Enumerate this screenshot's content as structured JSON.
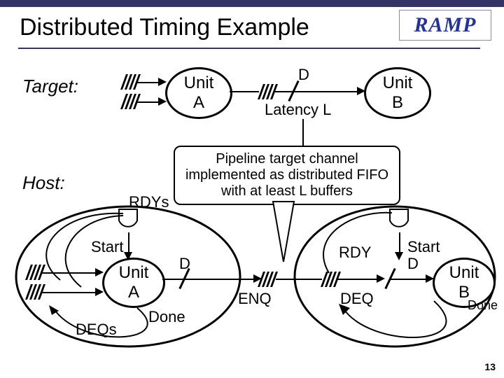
{
  "slide": {
    "title": "Distributed Timing Example",
    "page_number": "13"
  },
  "logo": {
    "text": "RAMP"
  },
  "sections": {
    "target": "Target:",
    "host": "Host:"
  },
  "units": {
    "a": "Unit\nA",
    "b": "Unit\nB"
  },
  "signals": {
    "d": "D",
    "latency": "Latency L",
    "rdys": "RDYs",
    "rdy": "RDY",
    "start": "Start",
    "enq": "ENQ",
    "deq": "DEQ",
    "deqs": "DEQs",
    "done": "Done"
  },
  "callout": {
    "text": "Pipeline target channel implemented as distributed FIFO with at least L buffers"
  },
  "chart_data": {
    "type": "table",
    "description": "Block diagram: two abstraction levels (Target, Host) mapping Unit A → channel of latency L → Unit B; host side shows distributed FIFO with ENQ/DEQ, RDY/Start/Done control and AND gates.",
    "target_level": {
      "nodes": [
        "Unit A",
        "Unit B"
      ],
      "channel": {
        "data_label": "D",
        "latency_label": "Latency L"
      }
    },
    "host_level": {
      "nodes": [
        "Unit A",
        "Unit B"
      ],
      "fifo_ops": [
        "ENQ",
        "DEQ"
      ],
      "control_signals": [
        "RDYs",
        "RDY",
        "Start",
        "Done",
        "DEQs"
      ],
      "gates": [
        "AND",
        "AND"
      ]
    }
  }
}
